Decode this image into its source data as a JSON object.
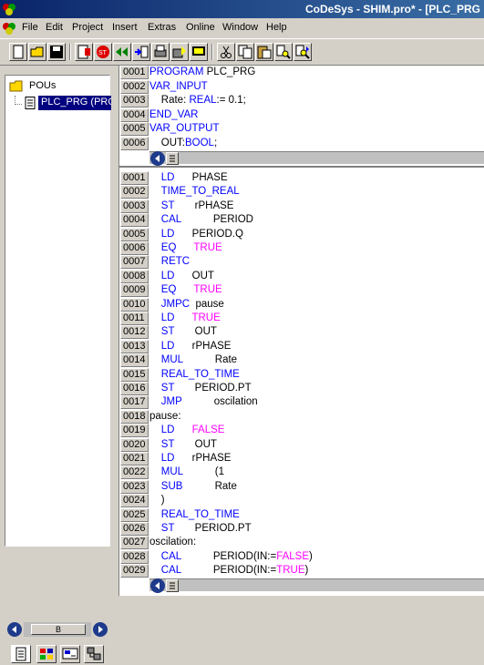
{
  "window": {
    "title": "CoDeSys - SHIM.pro* - [PLC_PRG"
  },
  "menu": [
    "File",
    "Edit",
    "Project",
    "Insert",
    "Extras",
    "Online",
    "Window",
    "Help"
  ],
  "toolbar": {
    "buttons": [
      "new-file-icon",
      "open-folder-icon",
      "save-icon",
      "build-icon",
      "login-icon",
      "stop-icon",
      "logout-icon",
      "step-icon",
      "print-icon",
      "run-icon",
      "cut-icon",
      "copy-icon",
      "paste-icon",
      "find-icon",
      "find-next-icon"
    ]
  },
  "tree": {
    "root_label": "POUs",
    "child_label": "PLC_PRG (PRG)"
  },
  "left_scroll": {
    "thumb_label": "B"
  },
  "declarations": [
    {
      "num": "0001",
      "parts": [
        [
          "kw",
          "PROGRAM "
        ],
        [
          "plain",
          "PLC_PRG"
        ]
      ]
    },
    {
      "num": "0002",
      "parts": [
        [
          "kw",
          "VAR_INPUT"
        ]
      ]
    },
    {
      "num": "0003",
      "parts": [
        [
          "plain",
          "    Rate: "
        ],
        [
          "kw",
          "REAL"
        ],
        [
          "plain",
          ":= 0.1;"
        ]
      ]
    },
    {
      "num": "0004",
      "parts": [
        [
          "kw",
          "END_VAR"
        ]
      ]
    },
    {
      "num": "0005",
      "parts": [
        [
          "kw",
          "VAR_OUTPUT"
        ]
      ]
    },
    {
      "num": "0006",
      "parts": [
        [
          "plain",
          "    OUT:"
        ],
        [
          "kw",
          "BOOL"
        ],
        [
          "plain",
          ";"
        ]
      ]
    }
  ],
  "body": [
    {
      "num": "0001",
      "parts": [
        [
          "plain",
          "    "
        ],
        [
          "kw",
          "LD"
        ],
        [
          "plain",
          "      PHASE"
        ]
      ]
    },
    {
      "num": "0002",
      "parts": [
        [
          "plain",
          "    "
        ],
        [
          "kw",
          "TIME_TO_REAL"
        ]
      ]
    },
    {
      "num": "0003",
      "parts": [
        [
          "plain",
          "    "
        ],
        [
          "kw",
          "ST"
        ],
        [
          "plain",
          "       rPHASE"
        ]
      ]
    },
    {
      "num": "0004",
      "parts": [
        [
          "plain",
          "    "
        ],
        [
          "kw",
          "CAL"
        ],
        [
          "plain",
          "           PERIOD"
        ]
      ]
    },
    {
      "num": "0005",
      "parts": [
        [
          "plain",
          "    "
        ],
        [
          "kw",
          "LD"
        ],
        [
          "plain",
          "      PERIOD.Q"
        ]
      ]
    },
    {
      "num": "0006",
      "parts": [
        [
          "plain",
          "    "
        ],
        [
          "kw",
          "EQ"
        ],
        [
          "plain",
          "      "
        ],
        [
          "lit",
          "TRUE"
        ]
      ]
    },
    {
      "num": "0007",
      "parts": [
        [
          "plain",
          "    "
        ],
        [
          "kw",
          "RETC"
        ]
      ]
    },
    {
      "num": "0008",
      "parts": [
        [
          "plain",
          "    "
        ],
        [
          "kw",
          "LD"
        ],
        [
          "plain",
          "      OUT"
        ]
      ]
    },
    {
      "num": "0009",
      "parts": [
        [
          "plain",
          "    "
        ],
        [
          "kw",
          "EQ"
        ],
        [
          "plain",
          "      "
        ],
        [
          "lit",
          "TRUE"
        ]
      ]
    },
    {
      "num": "0010",
      "parts": [
        [
          "plain",
          "    "
        ],
        [
          "kw",
          "JMPC"
        ],
        [
          "plain",
          "  pause"
        ]
      ]
    },
    {
      "num": "0011",
      "parts": [
        [
          "plain",
          "    "
        ],
        [
          "kw",
          "LD"
        ],
        [
          "plain",
          "      "
        ],
        [
          "lit",
          "TRUE"
        ]
      ]
    },
    {
      "num": "0012",
      "parts": [
        [
          "plain",
          "    "
        ],
        [
          "kw",
          "ST"
        ],
        [
          "plain",
          "       OUT"
        ]
      ]
    },
    {
      "num": "0013",
      "parts": [
        [
          "plain",
          "    "
        ],
        [
          "kw",
          "LD"
        ],
        [
          "plain",
          "      rPHASE"
        ]
      ]
    },
    {
      "num": "0014",
      "parts": [
        [
          "plain",
          "    "
        ],
        [
          "kw",
          "MUL"
        ],
        [
          "plain",
          "           Rate"
        ]
      ]
    },
    {
      "num": "0015",
      "parts": [
        [
          "plain",
          "    "
        ],
        [
          "kw",
          "REAL_TO_TIME"
        ]
      ]
    },
    {
      "num": "0016",
      "parts": [
        [
          "plain",
          "    "
        ],
        [
          "kw",
          "ST"
        ],
        [
          "plain",
          "       PERIOD.PT"
        ]
      ]
    },
    {
      "num": "0017",
      "parts": [
        [
          "plain",
          "    "
        ],
        [
          "kw",
          "JMP"
        ],
        [
          "plain",
          "           oscilation"
        ]
      ]
    },
    {
      "num": "0018",
      "parts": [
        [
          "plain",
          "pause:"
        ]
      ]
    },
    {
      "num": "0019",
      "parts": [
        [
          "plain",
          "    "
        ],
        [
          "kw",
          "LD"
        ],
        [
          "plain",
          "      "
        ],
        [
          "lit",
          "FALSE"
        ]
      ]
    },
    {
      "num": "0020",
      "parts": [
        [
          "plain",
          "    "
        ],
        [
          "kw",
          "ST"
        ],
        [
          "plain",
          "       OUT"
        ]
      ]
    },
    {
      "num": "0021",
      "parts": [
        [
          "plain",
          "    "
        ],
        [
          "kw",
          "LD"
        ],
        [
          "plain",
          "      rPHASE"
        ]
      ]
    },
    {
      "num": "0022",
      "parts": [
        [
          "plain",
          "    "
        ],
        [
          "kw",
          "MUL"
        ],
        [
          "plain",
          "           (1"
        ]
      ]
    },
    {
      "num": "0023",
      "parts": [
        [
          "plain",
          "    "
        ],
        [
          "kw",
          "SUB"
        ],
        [
          "plain",
          "           Rate"
        ]
      ]
    },
    {
      "num": "0024",
      "parts": [
        [
          "plain",
          "    )"
        ]
      ]
    },
    {
      "num": "0025",
      "parts": [
        [
          "plain",
          "    "
        ],
        [
          "kw",
          "REAL_TO_TIME"
        ]
      ]
    },
    {
      "num": "0026",
      "parts": [
        [
          "plain",
          "    "
        ],
        [
          "kw",
          "ST"
        ],
        [
          "plain",
          "       PERIOD.PT"
        ]
      ]
    },
    {
      "num": "0027",
      "parts": [
        [
          "plain",
          "oscilation:"
        ]
      ]
    },
    {
      "num": "0028",
      "parts": [
        [
          "plain",
          "    "
        ],
        [
          "kw",
          "CAL"
        ],
        [
          "plain",
          "           PERIOD(IN:="
        ],
        [
          "lit",
          "FALSE"
        ],
        [
          "plain",
          ")"
        ]
      ]
    },
    {
      "num": "0029",
      "parts": [
        [
          "plain",
          "    "
        ],
        [
          "kw",
          "CAL"
        ],
        [
          "plain",
          "           PERIOD(IN:="
        ],
        [
          "lit",
          "TRUE"
        ],
        [
          "plain",
          ")"
        ]
      ]
    }
  ]
}
